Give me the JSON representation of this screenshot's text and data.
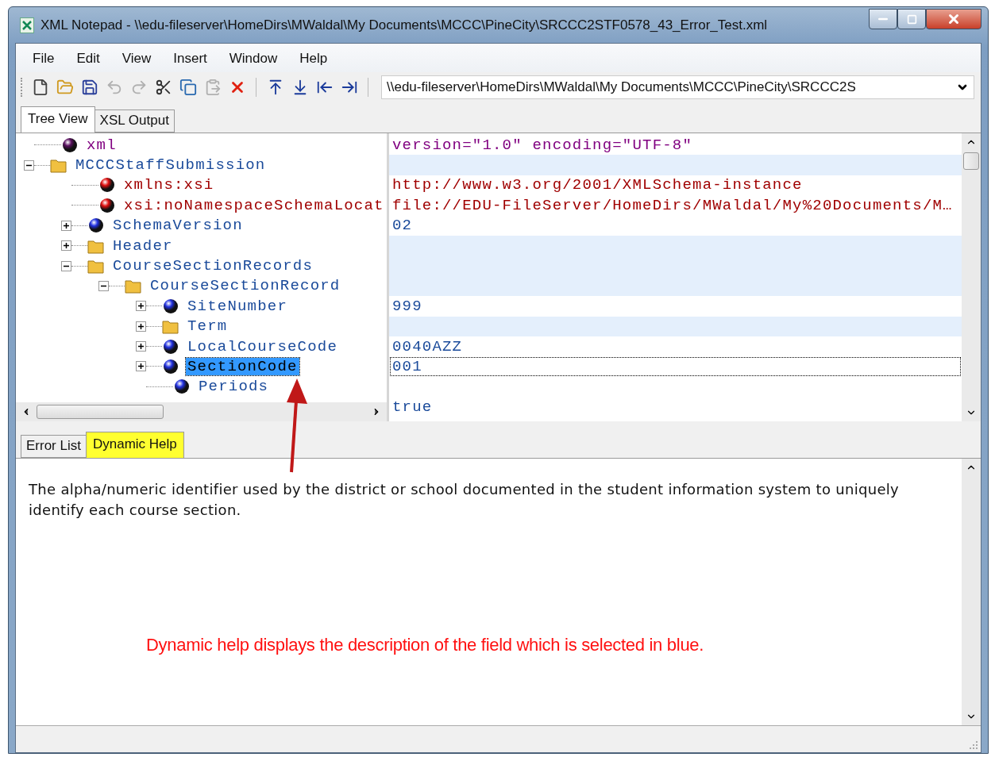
{
  "window": {
    "title": "XML Notepad - \\\\edu-fileserver\\HomeDirs\\MWaldal\\My Documents\\MCCC\\PineCity\\SRCCC2STF0578_43_Error_Test.xml"
  },
  "menu": [
    "File",
    "Edit",
    "View",
    "Insert",
    "Window",
    "Help"
  ],
  "toolbar": [
    {
      "kind": "new",
      "disabled": false
    },
    {
      "kind": "open",
      "disabled": false
    },
    {
      "kind": "save",
      "disabled": false
    },
    {
      "kind": "undo",
      "disabled": true
    },
    {
      "kind": "redo",
      "disabled": true
    },
    {
      "kind": "cut",
      "disabled": false
    },
    {
      "kind": "copy",
      "disabled": false
    },
    {
      "kind": "paste",
      "disabled": true
    },
    {
      "kind": "delete",
      "disabled": false
    },
    {
      "kind": "sep"
    },
    {
      "kind": "up",
      "disabled": false
    },
    {
      "kind": "down",
      "disabled": false
    },
    {
      "kind": "left",
      "disabled": false
    },
    {
      "kind": "right",
      "disabled": false
    }
  ],
  "address": {
    "value": "\\\\edu-fileserver\\HomeDirs\\MWaldal\\My Documents\\MCCC\\PineCity\\SRCCC2S"
  },
  "view_tabs": [
    {
      "label": "Tree View",
      "selected": true
    },
    {
      "label": "XSL Output",
      "selected": false
    }
  ],
  "tree": [
    {
      "label": "xml",
      "kind": "pi",
      "selected": false
    },
    {
      "label": "MCCCStaffSubmission",
      "kind": "folder",
      "expanded": true,
      "selected": false,
      "children": [
        {
          "label": "xmlns:xsi",
          "kind": "attribute",
          "selected": false
        },
        {
          "label": "xsi:noNamespaceSchemaLocat",
          "kind": "attribute",
          "selected": false
        },
        {
          "label": "SchemaVersion",
          "kind": "element",
          "expanded": false,
          "selected": false
        },
        {
          "label": "Header",
          "kind": "folder",
          "expanded": false,
          "selected": false
        },
        {
          "label": "CourseSectionRecords",
          "kind": "folder",
          "expanded": true,
          "selected": false,
          "children": [
            {
              "label": "CourseSectionRecord",
              "kind": "folder",
              "expanded": true,
              "selected": false,
              "children": [
                {
                  "label": "SiteNumber",
                  "kind": "element",
                  "expanded": false,
                  "selected": false
                },
                {
                  "label": "Term",
                  "kind": "folder",
                  "expanded": false,
                  "selected": false
                },
                {
                  "label": "LocalCourseCode",
                  "kind": "element",
                  "expanded": false,
                  "selected": false
                },
                {
                  "label": "SectionCode",
                  "kind": "element",
                  "expanded": false,
                  "selected": true
                },
                {
                  "label": "Periods",
                  "kind": "element",
                  "selected": false
                }
              ]
            }
          ]
        }
      ]
    }
  ],
  "values": [
    {
      "text": "version=\"1.0\" encoding=\"UTF-8\"",
      "kind": "pi",
      "shaded": false,
      "selected": false
    },
    {
      "shaded": true,
      "selected": false
    },
    {
      "text": "http://www.w3.org/2001/XMLSchema-instance",
      "kind": "attribute",
      "shaded": false,
      "selected": false
    },
    {
      "text": "file://EDU-FileServer/HomeDirs/MWaldal/My%20Documents/M…",
      "kind": "attribute",
      "shaded": false,
      "selected": false
    },
    {
      "text": "02",
      "kind": "element",
      "shaded": false,
      "selected": false
    },
    {
      "shaded": true,
      "selected": false
    },
    {
      "shaded": true,
      "selected": false
    },
    {
      "shaded": true,
      "selected": false
    },
    {
      "text": "999",
      "kind": "element",
      "shaded": false,
      "selected": false
    },
    {
      "shaded": true,
      "selected": false
    },
    {
      "text": "0040AZZ",
      "kind": "element",
      "shaded": false,
      "selected": false
    },
    {
      "text": "001",
      "kind": "element",
      "shaded": false,
      "selected": true
    },
    {
      "shaded": false,
      "selected": false
    },
    {
      "text": "true",
      "kind": "element",
      "shaded": false,
      "selected": false
    }
  ],
  "bottom_tabs": [
    {
      "label": "Error List",
      "selected": false
    },
    {
      "label": "Dynamic Help",
      "selected": true
    }
  ],
  "help_text": "The alpha/numeric identifier used by the district or school documented in the student information system to uniquely identify each course section.",
  "annotation": "Dynamic help displays the description of the field which is selected in blue."
}
